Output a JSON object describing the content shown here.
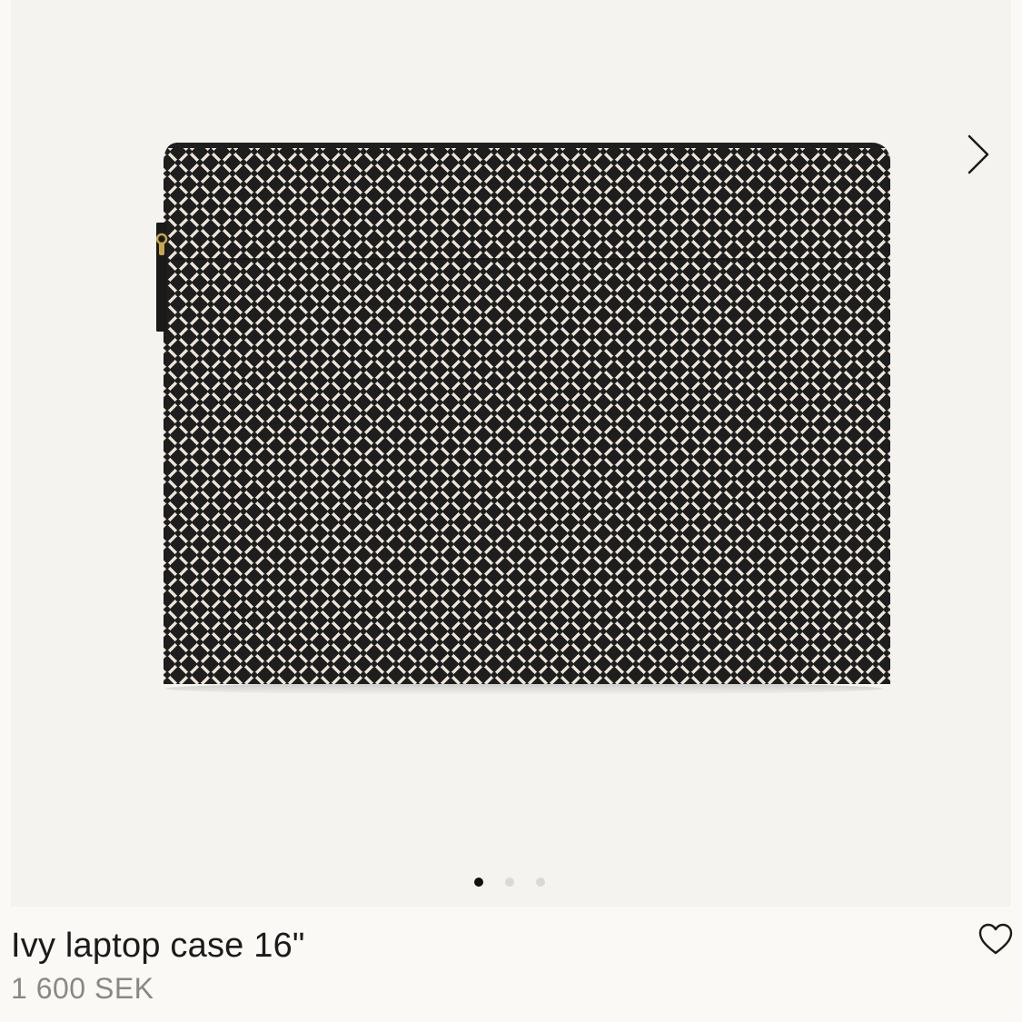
{
  "product": {
    "title": "Ivy laptop case 16\"",
    "price": "1 600 SEK"
  },
  "gallery": {
    "image_count": 3,
    "active_index": 0,
    "next_icon": "chevron-right-icon"
  },
  "actions": {
    "wishlist_icon": "heart-outline-icon"
  },
  "colors": {
    "background": "#fbf9f6",
    "gallery_background": "#f5f3f0",
    "case_dark": "#1e1e1e",
    "case_pattern": "#efe6da",
    "title_text": "#1b1b1b",
    "price_text": "#8a8784",
    "dot_active": "#111111",
    "dot_inactive": "#dcd9d5"
  }
}
